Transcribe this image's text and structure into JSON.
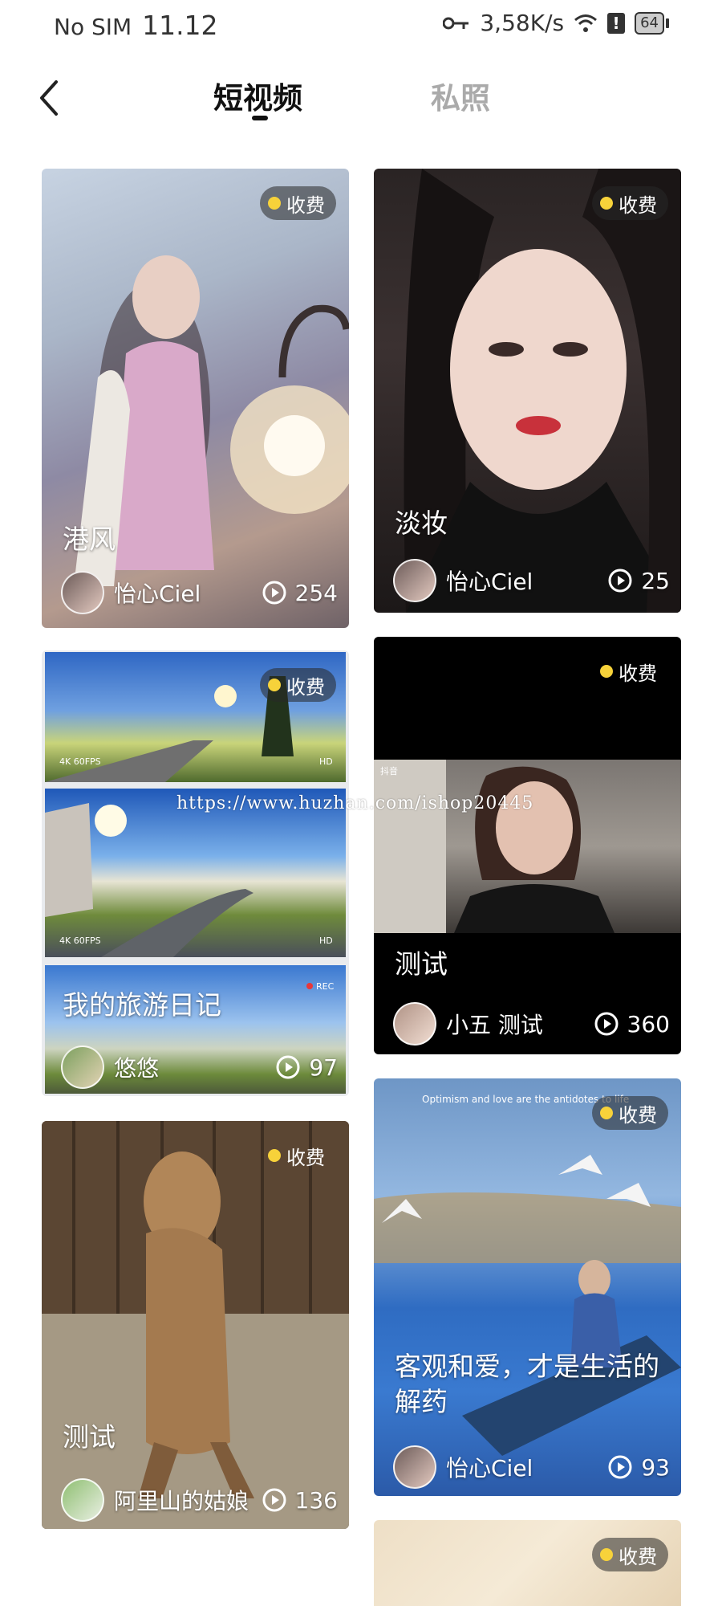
{
  "status_bar": {
    "carrier": "No SIM",
    "time": "11.12",
    "network_speed": "3,58K/s",
    "battery": "64",
    "icons": [
      "key-icon",
      "wifi-icon",
      "alert-icon",
      "battery-icon"
    ]
  },
  "nav": {
    "back_icon": "chevron-left-icon",
    "tabs": [
      {
        "label": "短视频",
        "active": true
      },
      {
        "label": "私照",
        "active": false
      }
    ]
  },
  "watermark": "https://www.huzhan.com/ishop20445",
  "cards": [
    {
      "title": "港风",
      "author": "怡心Ciel",
      "plays": "254",
      "fee_label": "收费"
    },
    {
      "title": "淡妆",
      "author": "怡心Ciel",
      "plays": "25",
      "fee_label": "收费"
    },
    {
      "title": "我的旅游日记",
      "author": "悠悠",
      "plays": "97",
      "fee_label": "收费"
    },
    {
      "title": "测试",
      "author": "小五 测试",
      "plays": "360",
      "fee_label": "收费"
    },
    {
      "title": "测试",
      "author": "阿里山的姑娘",
      "plays": "136",
      "fee_label": "收费"
    },
    {
      "title": "客观和爱，才是生活的解药",
      "author": "怡心Ciel",
      "plays": "93",
      "fee_label": "收费"
    },
    {
      "title": "",
      "author": "",
      "plays": "",
      "fee_label": "收费"
    }
  ],
  "colors": {
    "fee_dot": "#f7d23a",
    "text_active": "#111111",
    "text_inactive": "#aaaaaa"
  }
}
